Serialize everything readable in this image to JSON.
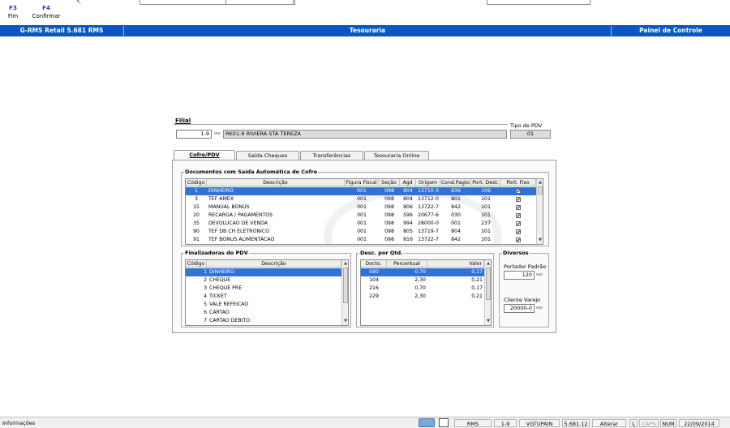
{
  "toolbar": {
    "buttons": [
      {
        "key": "F3",
        "label": "Fim"
      },
      {
        "key": "F4",
        "label": "Confirmar"
      }
    ]
  },
  "titlebar": {
    "app": "G-RMS Retail 5.681 RMS",
    "module": "Tesouraria",
    "panel": "Painel de Controle"
  },
  "filial": {
    "label": "Filial",
    "code": "1-9",
    "name": "RK01-9 RIVIERA STA TEREZA",
    "tipo_pdv_label": "Tipo de PDV",
    "tipo_pdv_value": "01"
  },
  "tabs": [
    {
      "label": "Cofre/PDV",
      "active": true
    },
    {
      "label": "Saída Cheques",
      "active": false
    },
    {
      "label": "Transferências",
      "active": false
    },
    {
      "label": "Tesouraria Online",
      "active": false
    }
  ],
  "documentos": {
    "title": "Documentos com Saída Automática do Cofre",
    "columns": [
      "Código",
      "Descrição",
      "Figura Fiscal",
      "Seção",
      "Agd",
      "Origem",
      "Cond.Pagto",
      "Port. Dest.",
      "Port. Fixo"
    ],
    "rows": [
      {
        "codigo": "1",
        "descricao": "DINHEIRO",
        "figura": "001",
        "secao": "098",
        "agd": "804",
        "origem": "13710-3",
        "cond": "836",
        "port_dest": "106",
        "fixo": "✔",
        "selected": true
      },
      {
        "codigo": "3",
        "descricao": "TEF AMEX",
        "figura": "001",
        "secao": "098",
        "agd": "804",
        "origem": "13712-0",
        "cond": "801",
        "port_dest": "101",
        "fixo": "✔",
        "selected": false
      },
      {
        "codigo": "15",
        "descricao": "MANUAL BONUS",
        "figura": "001",
        "secao": "098",
        "agd": "806",
        "origem": "13722-7",
        "cond": "842",
        "port_dest": "101",
        "fixo": "✔",
        "selected": false
      },
      {
        "codigo": "20",
        "descricao": "RECARGA / PAGAMENTOS",
        "figura": "001",
        "secao": "098",
        "agd": "596",
        "origem": "20677-6",
        "cond": "030",
        "port_dest": "101",
        "fixo": "✔",
        "selected": false
      },
      {
        "codigo": "35",
        "descricao": "DEVOLUCAO DE VENDA",
        "figura": "001",
        "secao": "098",
        "agd": "994",
        "origem": "28000-0",
        "cond": "001",
        "port_dest": "237",
        "fixo": "✔",
        "selected": false
      },
      {
        "codigo": "90",
        "descricao": "TEF DB CH ELETRONICO",
        "figura": "001",
        "secao": "098",
        "agd": "805",
        "origem": "13719-7",
        "cond": "804",
        "port_dest": "101",
        "fixo": "✔",
        "selected": false
      },
      {
        "codigo": "91",
        "descricao": "TEF BONUS ALIMENTACAO",
        "figura": "001",
        "secao": "098",
        "agd": "816",
        "origem": "13722-7",
        "cond": "842",
        "port_dest": "101",
        "fixo": "✔",
        "selected": false
      }
    ]
  },
  "finalizadoras": {
    "title": "Finalizadoras do PDV",
    "columns": [
      "Código",
      "Descrição"
    ],
    "rows": [
      {
        "codigo": "1",
        "descricao": "DINHEIRO",
        "selected": true
      },
      {
        "codigo": "2",
        "descricao": "CHEQUE",
        "selected": false
      },
      {
        "codigo": "3",
        "descricao": "CHEQUE PRE",
        "selected": false
      },
      {
        "codigo": "4",
        "descricao": "TICKET",
        "selected": false
      },
      {
        "codigo": "5",
        "descricao": "VALE REFEICAO",
        "selected": false
      },
      {
        "codigo": "6",
        "descricao": "CARTAO",
        "selected": false
      },
      {
        "codigo": "7",
        "descricao": "CARTAO DEBITO",
        "selected": false
      }
    ]
  },
  "desconto": {
    "title": "Desc. por Qtd.",
    "columns": [
      "Docto.",
      "Percentual",
      "Valor"
    ],
    "rows": [
      {
        "docto": "090",
        "percentual": "0,70",
        "valor": "0,17",
        "selected": true
      },
      {
        "docto": "104",
        "percentual": "2,30",
        "valor": "0,21",
        "selected": false
      },
      {
        "docto": "216",
        "percentual": "0,70",
        "valor": "0,17",
        "selected": false
      },
      {
        "docto": "229",
        "percentual": "2,30",
        "valor": "0,21",
        "selected": false
      }
    ]
  },
  "diversos": {
    "title": "Diversos",
    "portador_label": "Portador Padrão",
    "portador_value": "120",
    "cliente_label": "Cliente Varejo",
    "cliente_value": "20000-0"
  },
  "statusbar": {
    "left": "Informações",
    "items": [
      "RMS",
      "1-9",
      "VGTUPAIN",
      "5.681.12",
      "Alterar",
      "L",
      "CAPS",
      "NUM",
      "22/09/2014"
    ]
  }
}
